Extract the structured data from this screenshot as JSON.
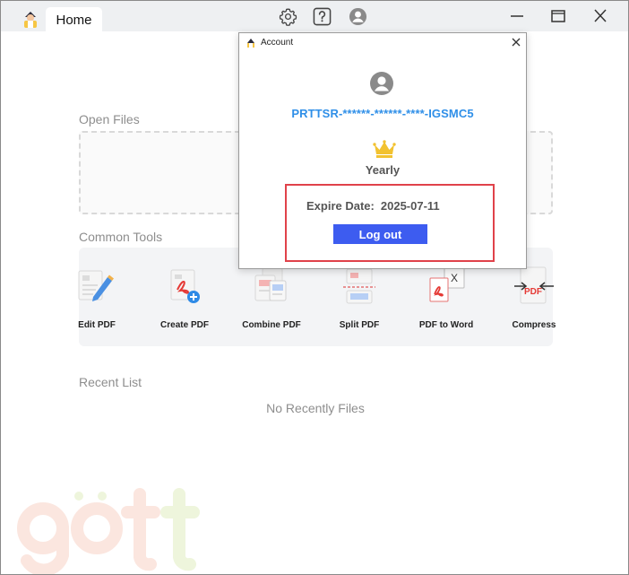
{
  "titlebar": {
    "tab_label": "Home",
    "icons": [
      "app-logo-icon",
      "gear-icon",
      "help-icon",
      "user-icon",
      "minimize-icon",
      "maximize-icon",
      "close-icon"
    ]
  },
  "main": {
    "open_files_label": "Open Files",
    "common_tools_label": "Common Tools",
    "tools": [
      {
        "label": "Edit PDF",
        "icon": "edit-pdf-icon"
      },
      {
        "label": "Create PDF",
        "icon": "create-pdf-icon"
      },
      {
        "label": "Combine PDF",
        "icon": "combine-pdf-icon"
      },
      {
        "label": "Split PDF",
        "icon": "split-pdf-icon"
      },
      {
        "label": "PDF to Word",
        "icon": "pdf-to-word-icon"
      },
      {
        "label": "Compress",
        "icon": "compress-pdf-icon"
      }
    ],
    "recent_list_label": "Recent List",
    "empty_recent_text": "No Recently Files"
  },
  "account_dialog": {
    "title": "Account",
    "license_key": "PRTTSR-******-******-****-IGSMC5",
    "plan": "Yearly",
    "expire_label": "Expire Date:",
    "expire_value": "2025-07-11",
    "logout_label": "Log out"
  },
  "colors": {
    "accent_blue": "#3d5cf0",
    "key_blue": "#2f8fe8",
    "highlight_red": "#e0424a",
    "crown_gold": "#f2c230",
    "pdf_red": "#e53935"
  }
}
